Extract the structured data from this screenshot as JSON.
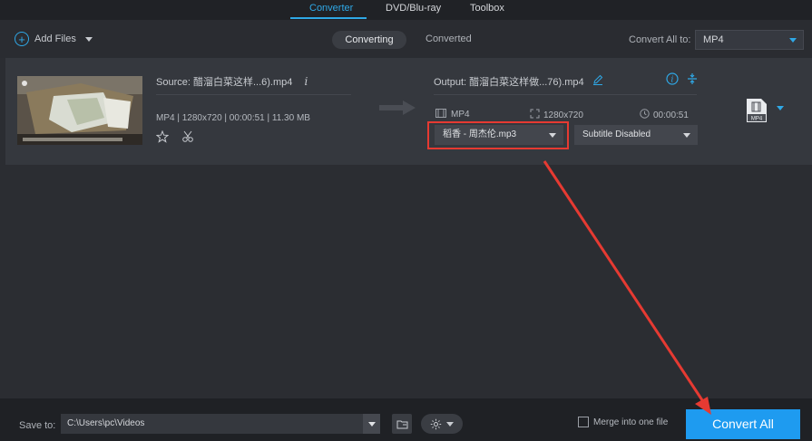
{
  "nav": {
    "tabs": [
      "Converter",
      "DVD/Blu-ray",
      "Toolbox"
    ],
    "active_tab": "Converter"
  },
  "toolbar": {
    "add_files": "Add Files",
    "segments": [
      "Converting",
      "Converted"
    ],
    "convert_all_label": "Convert All to:",
    "convert_all_value": "MP4"
  },
  "file": {
    "source_name": "Source: 醋溜白菜这样...6).mp4",
    "source_info": "MP4 | 1280x720 | 00:00:51 | 11.30 MB",
    "output_name": "Output: 醋溜白菜这样做...76).mp4",
    "output_format": "MP4",
    "output_resolution": "1280x720",
    "output_duration": "00:00:51",
    "audio_track": "稻香 - 周杰伦.mp3",
    "subtitle": "Subtitle Disabled",
    "format_badge": "MP4"
  },
  "bottom": {
    "save_to_label": "Save to:",
    "save_path": "C:\\Users\\pc\\Videos",
    "merge_label": "Merge into one file",
    "convert_button": "Convert All"
  },
  "colors": {
    "accent": "#1e9bf0",
    "highlight_red": "#e63a32"
  }
}
